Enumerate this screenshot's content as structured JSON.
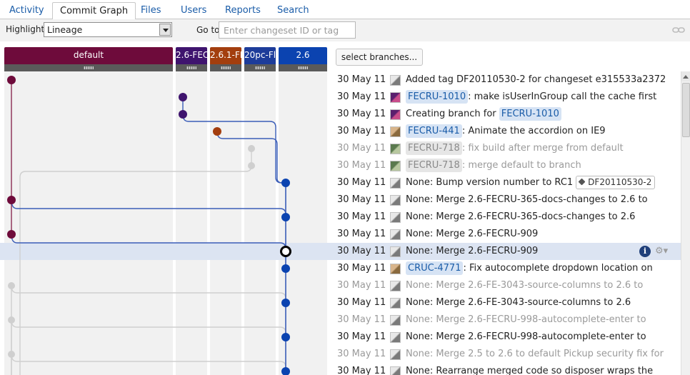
{
  "tabs": [
    {
      "label": "Activity"
    },
    {
      "label": "Commit Graph"
    },
    {
      "label": "Files"
    },
    {
      "label": "Users"
    },
    {
      "label": "Reports"
    },
    {
      "label": "Search"
    }
  ],
  "toolbar": {
    "highlight_label": "Highlight",
    "highlight_value": "Lineage",
    "goto_label": "Go to",
    "goto_placeholder": "Enter changeset ID or tag"
  },
  "branches": [
    {
      "name": "default",
      "color": "#6e0b3b"
    },
    {
      "name": "2.6-FEC",
      "color": "#3f146e"
    },
    {
      "name": "2.6.1-FI",
      "color": "#a33e0e"
    },
    {
      "name": "20pc-Fl",
      "color": "#1d3c9a"
    },
    {
      "name": "2.6",
      "color": "#0b43b0"
    }
  ],
  "select_branches_label": "select branches...",
  "commits": [
    {
      "date": "30 May 11",
      "avatar": "user-gray",
      "pre": "Added tag DF20110530-2 for changeset e315533a2372",
      "key": "",
      "post": "",
      "tag": "",
      "dim": false
    },
    {
      "date": "30 May 11",
      "avatar": "user-purple",
      "pre": "",
      "key": "FECRU-1010",
      "post": ": make isUserInGroup call the cache first",
      "tag": "",
      "dim": false
    },
    {
      "date": "30 May 11",
      "avatar": "user-purple",
      "pre": "Creating branch for ",
      "key": "FECRU-1010",
      "post": "",
      "tag": "",
      "dim": false
    },
    {
      "date": "30 May 11",
      "avatar": "user-photo",
      "pre": "",
      "key": "FECRU-441",
      "post": ": Animate the accordion on IE9",
      "tag": "",
      "dim": false
    },
    {
      "date": "30 May 11",
      "avatar": "user-green",
      "pre": "",
      "key": "FECRU-718",
      "post": ": fix build after merge from default",
      "tag": "",
      "dim": true
    },
    {
      "date": "30 May 11",
      "avatar": "user-green",
      "pre": "",
      "key": "FECRU-718",
      "post": ": merge default to branch",
      "tag": "",
      "dim": true
    },
    {
      "date": "30 May 11",
      "avatar": "user-gray",
      "pre": "None: Bump version number to RC1",
      "key": "",
      "post": "",
      "tag": "DF20110530-2",
      "dim": false
    },
    {
      "date": "30 May 11",
      "avatar": "user-gray",
      "pre": "None: Merge 2.6-FECRU-365-docs-changes to 2.6 to",
      "key": "",
      "post": "",
      "tag": "",
      "dim": false
    },
    {
      "date": "30 May 11",
      "avatar": "user-gray",
      "pre": "None: Merge 2.6-FECRU-365-docs-changes to 2.6",
      "key": "",
      "post": "",
      "tag": "",
      "dim": false
    },
    {
      "date": "30 May 11",
      "avatar": "user-gray",
      "pre": "None: Merge 2.6-FECRU-909",
      "key": "",
      "post": "",
      "tag": "",
      "dim": false
    },
    {
      "date": "30 May 11",
      "avatar": "user-gray",
      "pre": "None: Merge 2.6-FECRU-909",
      "key": "",
      "post": "",
      "tag": "",
      "dim": false
    },
    {
      "date": "30 May 11",
      "avatar": "user-photo",
      "pre": "",
      "key": "CRUC-4771",
      "post": ": Fix autocomplete dropdown location on",
      "tag": "",
      "dim": false
    },
    {
      "date": "30 May 11",
      "avatar": "user-gray",
      "pre": "None: Merge 2.6-FE-3043-source-columns to 2.6 to",
      "key": "",
      "post": "",
      "tag": "",
      "dim": true
    },
    {
      "date": "30 May 11",
      "avatar": "user-gray",
      "pre": "None: Merge 2.6-FE-3043-source-columns to 2.6",
      "key": "",
      "post": "",
      "tag": "",
      "dim": false
    },
    {
      "date": "30 May 11",
      "avatar": "user-gray",
      "pre": "None: Merge 2.6-FECRU-998-autocomplete-enter to",
      "key": "",
      "post": "",
      "tag": "",
      "dim": true
    },
    {
      "date": "30 May 11",
      "avatar": "user-gray",
      "pre": "None: Merge 2.6-FECRU-998-autocomplete-enter to",
      "key": "",
      "post": "",
      "tag": "",
      "dim": false
    },
    {
      "date": "30 May 11",
      "avatar": "user-gray",
      "pre": "None: Merge 2.5 to 2.6 to default Pickup security fix for",
      "key": "",
      "post": "",
      "tag": "",
      "dim": true
    },
    {
      "date": "30 May 11",
      "avatar": "user-gray",
      "pre": "None: Rearrange merged code so disposer wraps the",
      "key": "",
      "post": "",
      "tag": "",
      "dim": false
    }
  ],
  "selected_row": 10,
  "row_actions": {
    "info_icon": "info-icon",
    "gear_icon": "gear-icon",
    "info_glyph": "i",
    "gear_glyph": "⚙▾"
  }
}
